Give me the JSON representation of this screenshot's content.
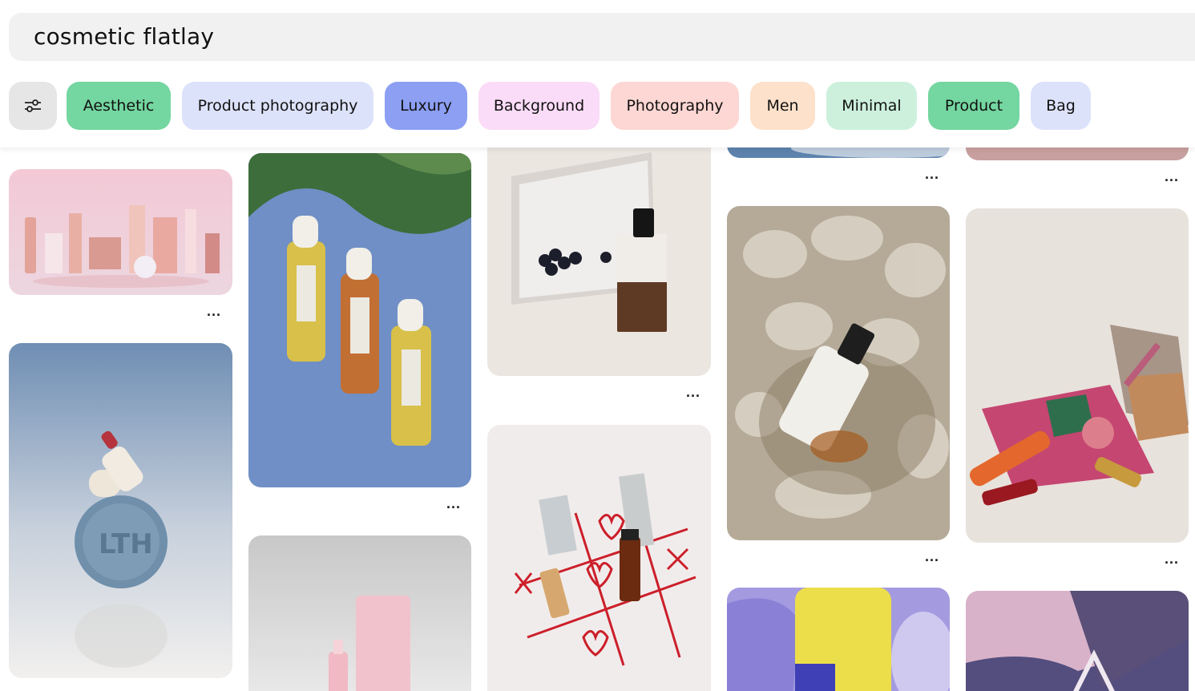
{
  "search": {
    "query": "cosmetic flatlay"
  },
  "filter_button": {
    "icon": "sliders-icon"
  },
  "chips": [
    {
      "label": "Aesthetic",
      "color": "#74d6a0"
    },
    {
      "label": "Product photography",
      "color": "#dde2fb"
    },
    {
      "label": "Luxury",
      "color": "#8c9ff3"
    },
    {
      "label": "Background",
      "color": "#fbdcf8"
    },
    {
      "label": "Photography",
      "color": "#fdd7d3"
    },
    {
      "label": "Men",
      "color": "#fde1cb"
    },
    {
      "label": "Minimal",
      "color": "#ccf0dc"
    },
    {
      "label": "Product",
      "color": "#74d6a0"
    },
    {
      "label": "Bag",
      "color": "#dde2fb"
    }
  ],
  "pins": [
    {
      "subject": "pink-makeup-collection-image"
    },
    {
      "subject": "blue-soap-bottle-image"
    },
    {
      "subject": "serum-bottles-reflection-image"
    },
    {
      "subject": "pink-tube-image"
    },
    {
      "subject": "mirror-perfume-image"
    },
    {
      "subject": "tic-tac-toe-lipstick-image"
    },
    {
      "subject": "top-cropped-blue-image"
    },
    {
      "subject": "dropper-bottle-water-image"
    },
    {
      "subject": "yellow-product-image"
    },
    {
      "subject": "top-cropped-pink-image"
    },
    {
      "subject": "eyeshadow-palette-image"
    },
    {
      "subject": "pink-purple-shapes-image"
    }
  ],
  "more_options": {
    "label": "..."
  }
}
